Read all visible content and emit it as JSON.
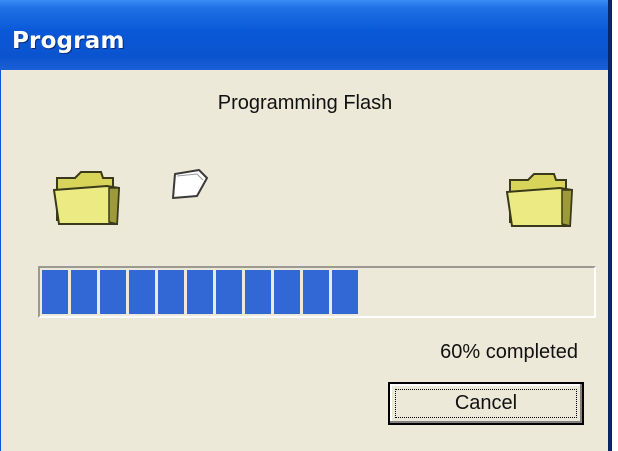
{
  "window": {
    "title": "Program"
  },
  "dialog": {
    "caption": "Programming Flash",
    "status_text": "60% completed",
    "cancel_label": "Cancel"
  },
  "progress": {
    "value_percent": 60,
    "filled_blocks": 11,
    "block_color": "#3168d5"
  },
  "icons": {
    "source": "folder-icon",
    "transfer": "document-icon",
    "destination": "folder-icon"
  },
  "colors": {
    "titlebar": "#0a58d8",
    "dialog_bg": "#ece9d8",
    "folder": "#e8e66f"
  }
}
